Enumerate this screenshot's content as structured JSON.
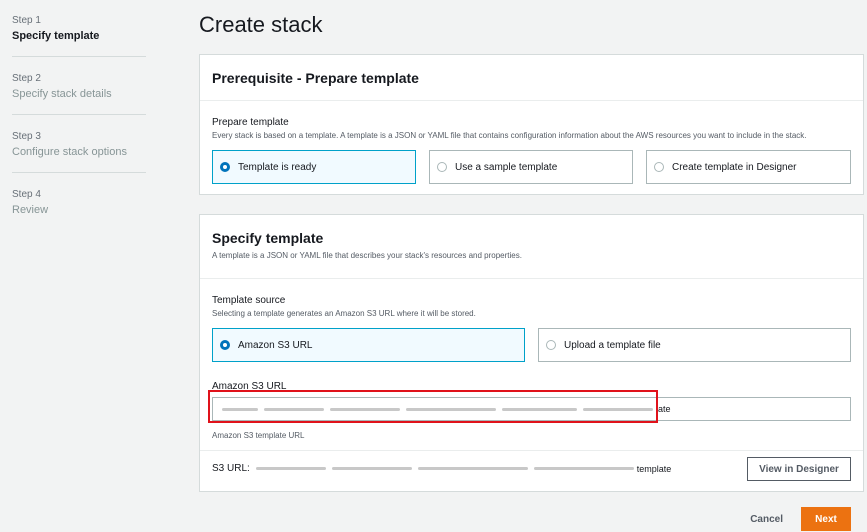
{
  "steps": [
    {
      "num": "Step 1",
      "title": "Specify template"
    },
    {
      "num": "Step 2",
      "title": "Specify stack details"
    },
    {
      "num": "Step 3",
      "title": "Configure stack options"
    },
    {
      "num": "Step 4",
      "title": "Review"
    }
  ],
  "page_title": "Create stack",
  "prereq": {
    "title": "Prerequisite - Prepare template",
    "field_label": "Prepare template",
    "field_desc": "Every stack is based on a template. A template is a JSON or YAML file that contains configuration information about the AWS resources you want to include in the stack.",
    "options": [
      "Template is ready",
      "Use a sample template",
      "Create template in Designer"
    ],
    "selected": "Template is ready"
  },
  "specify": {
    "title": "Specify template",
    "desc": "A template is a JSON or YAML file that describes your stack's resources and properties.",
    "source_label": "Template source",
    "source_desc": "Selecting a template generates an Amazon S3 URL where it will be stored.",
    "source_options": [
      "Amazon S3 URL",
      "Upload a template file"
    ],
    "source_selected": "Amazon S3 URL",
    "url_label": "Amazon S3 URL",
    "url_value_end": "late",
    "url_help": "Amazon S3 template URL",
    "s3_url_label": "S3 URL:",
    "s3_url_value_end": "template",
    "view_designer": "View in Designer"
  },
  "footer": {
    "cancel": "Cancel",
    "next": "Next"
  },
  "colors": {
    "accent_blue": "#0073bb",
    "primary_orange": "#ec7211",
    "highlight_red": "#e0121b"
  }
}
